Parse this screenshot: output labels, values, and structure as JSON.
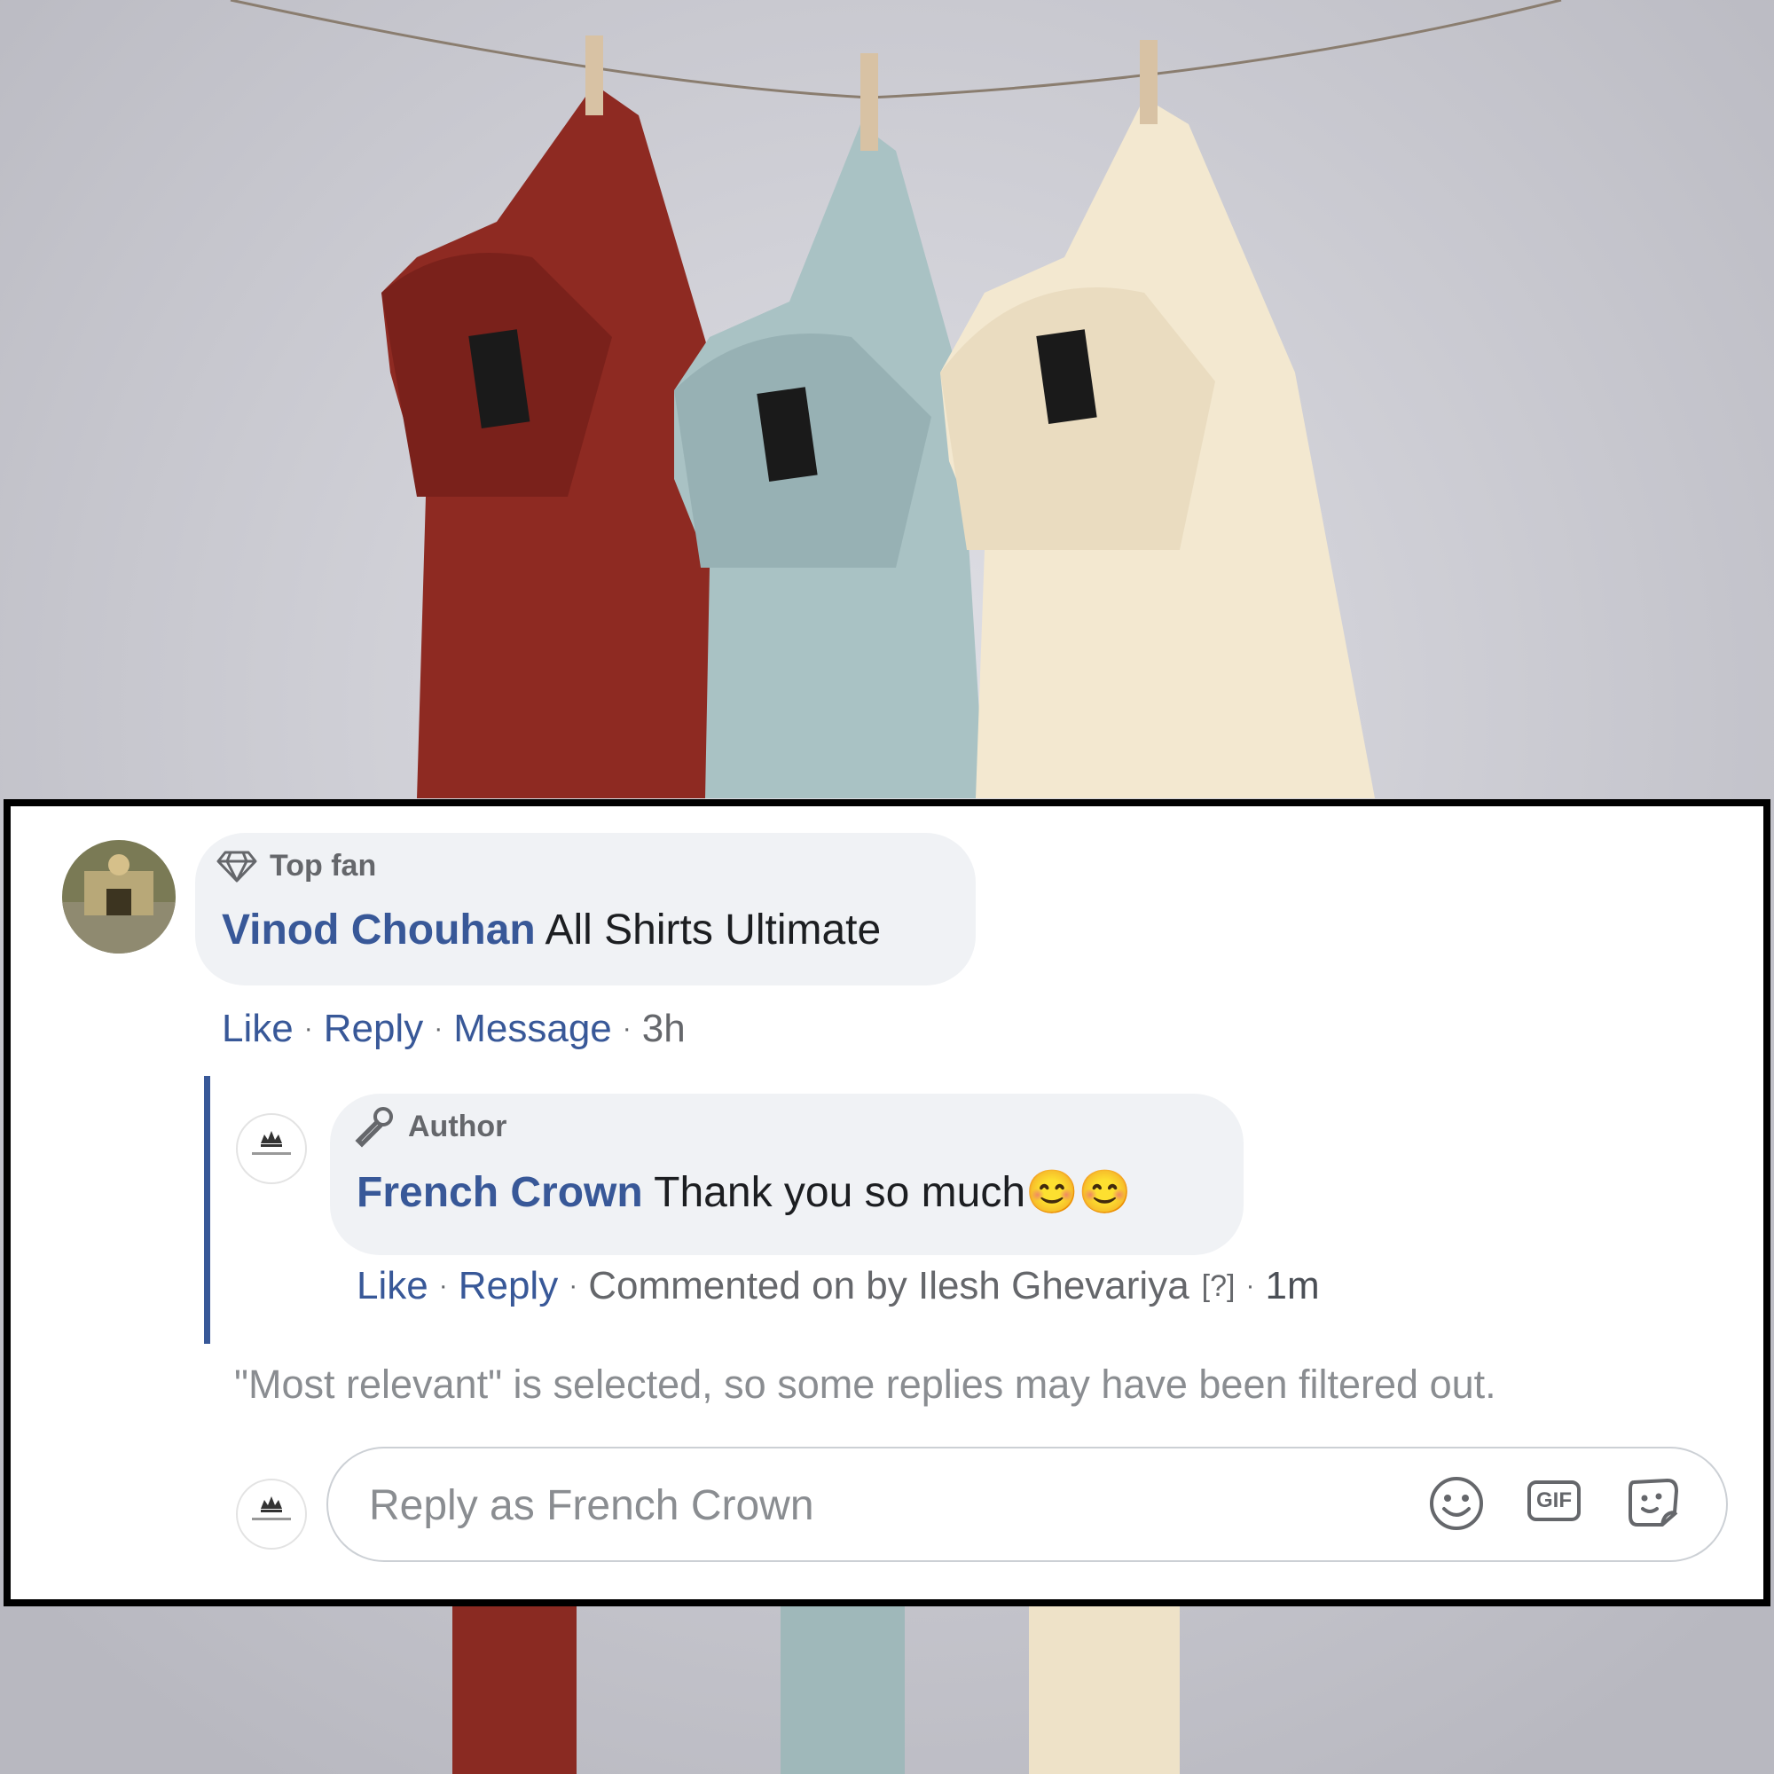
{
  "colors": {
    "link": "#385898",
    "muted": "#65676b",
    "bubble": "#f0f2f5",
    "shirt_red": "#8e2a22",
    "shirt_blue": "#a9c2c4",
    "shirt_cream": "#f3e8d0"
  },
  "comment": {
    "badge_icon": "diamond-icon",
    "badge": "Top fan",
    "author": "Vinod Chouhan",
    "text": "All Shirts Ultimate",
    "actions": {
      "like": "Like",
      "reply": "Reply",
      "message": "Message",
      "time": "3h"
    }
  },
  "reply": {
    "badge_icon": "microphone-icon",
    "badge": "Author",
    "author": "French Crown",
    "text": "Thank you so much",
    "emojis": "😊😊",
    "actions": {
      "like": "Like",
      "reply": "Reply",
      "commented_by": "Commented on by Ilesh Ghevariya",
      "help": "[?]",
      "time": "1m"
    }
  },
  "filter_notice": "\"Most relevant\" is selected, so some replies may have been filtered out.",
  "composer": {
    "placeholder": "Reply as French Crown",
    "icons": [
      "smiley-icon",
      "gif-icon",
      "sticker-icon"
    ],
    "gif_label": "GIF"
  }
}
